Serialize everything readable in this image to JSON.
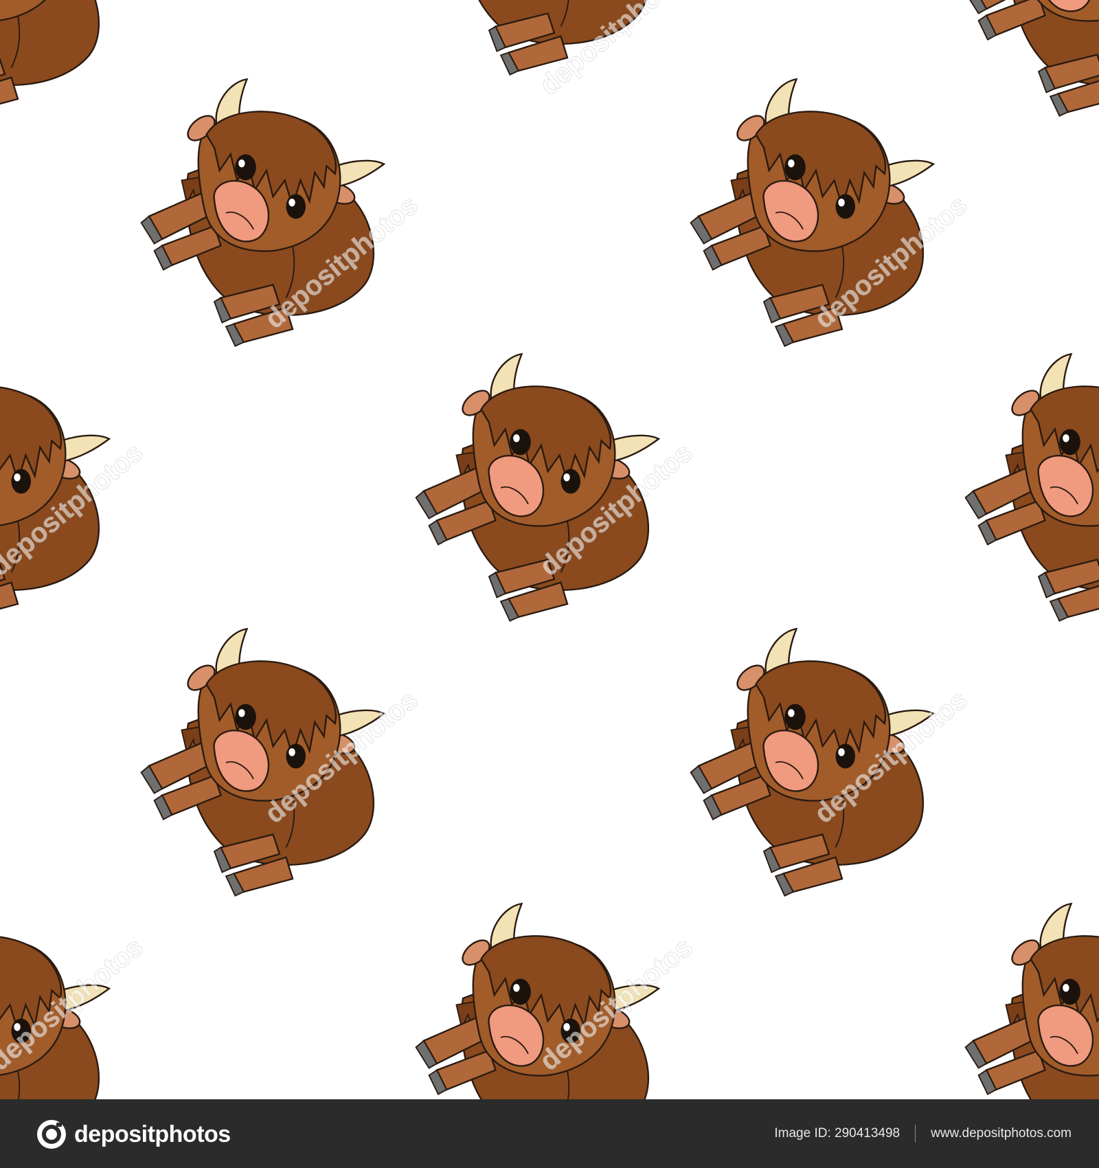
{
  "watermark": "depositphotos",
  "colors": {
    "background": "#ffffff",
    "fur": "#8a4a1e",
    "fur_light": "#a15c2a",
    "legs": "#b0683a",
    "hooves": "#6f6f6f",
    "horn": "#f2e2b5",
    "snout": "#f09a80",
    "outline": "#2a1a10",
    "footer": "#2b2b2b"
  },
  "footer": {
    "logo_text": "depositphotos",
    "image_id_label": "Image ID: 290413498",
    "site_url": "www.depositphotos.com"
  }
}
